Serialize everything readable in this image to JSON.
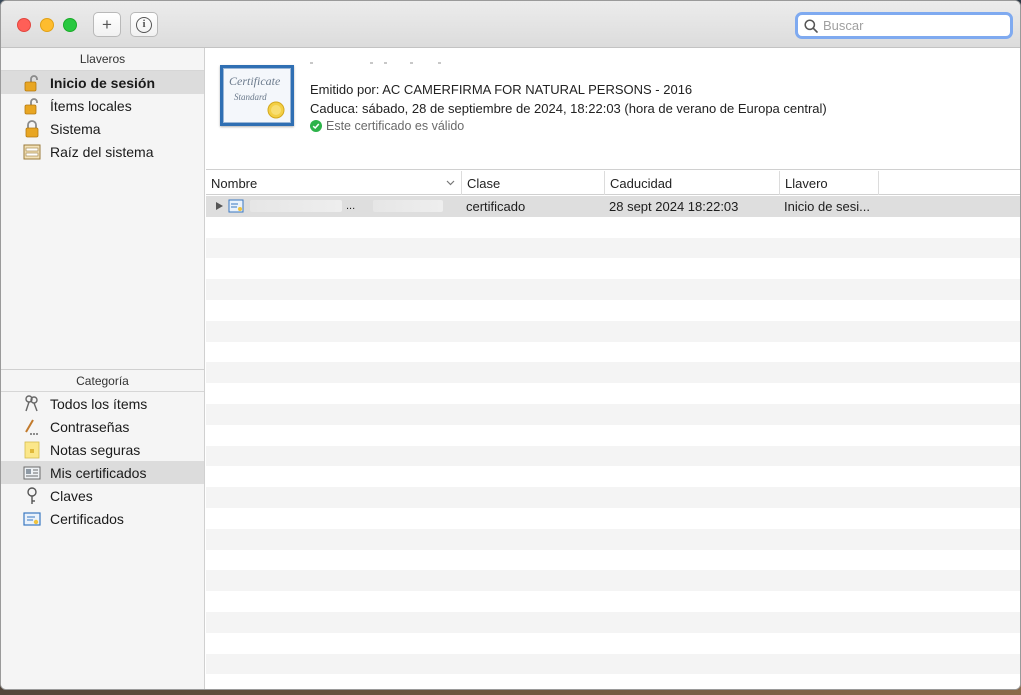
{
  "toolbar": {
    "add_label": "+",
    "info_label": "i"
  },
  "search": {
    "placeholder": "Buscar"
  },
  "sidebar": {
    "keychains_header": "Llaveros",
    "keychains": [
      {
        "label": "Inicio de sesión",
        "icon": "unlocked-padlock-icon"
      },
      {
        "label": "Ítems locales",
        "icon": "unlocked-padlock-icon"
      },
      {
        "label": "Sistema",
        "icon": "locked-padlock-icon"
      },
      {
        "label": "Raíz del sistema",
        "icon": "cabinet-icon"
      }
    ],
    "category_header": "Categoría",
    "categories": [
      {
        "label": "Todos los ítems",
        "icon": "keys-icon"
      },
      {
        "label": "Contraseñas",
        "icon": "pencil-dots-icon"
      },
      {
        "label": "Notas seguras",
        "icon": "note-icon"
      },
      {
        "label": "Mis certificados",
        "icon": "id-card-icon"
      },
      {
        "label": "Claves",
        "icon": "key-icon"
      },
      {
        "label": "Certificados",
        "icon": "certificate-icon"
      }
    ]
  },
  "cert": {
    "image_text_1": "Certificate",
    "image_text_2": "Standard",
    "issued_by": "Emitido por: AC CAMERFIRMA FOR NATURAL PERSONS - 2016",
    "expires": "Caduca: sábado, 28 de septiembre de 2024, 18:22:03 (hora de verano de Europa central)",
    "status": "Este certificado es válido"
  },
  "table": {
    "columns": [
      "Nombre",
      "Clase",
      "Caducidad",
      "Llavero"
    ],
    "rows": [
      {
        "name_suffix": "...",
        "class": "certificado",
        "expires": "28 sept 2024 18:22:03",
        "keychain": "Inicio de sesi..."
      }
    ]
  },
  "colors": {
    "accent_search_ring": "#7faaf0",
    "selected_row": "#dcdcdc",
    "valid_green": "#2db34a"
  }
}
